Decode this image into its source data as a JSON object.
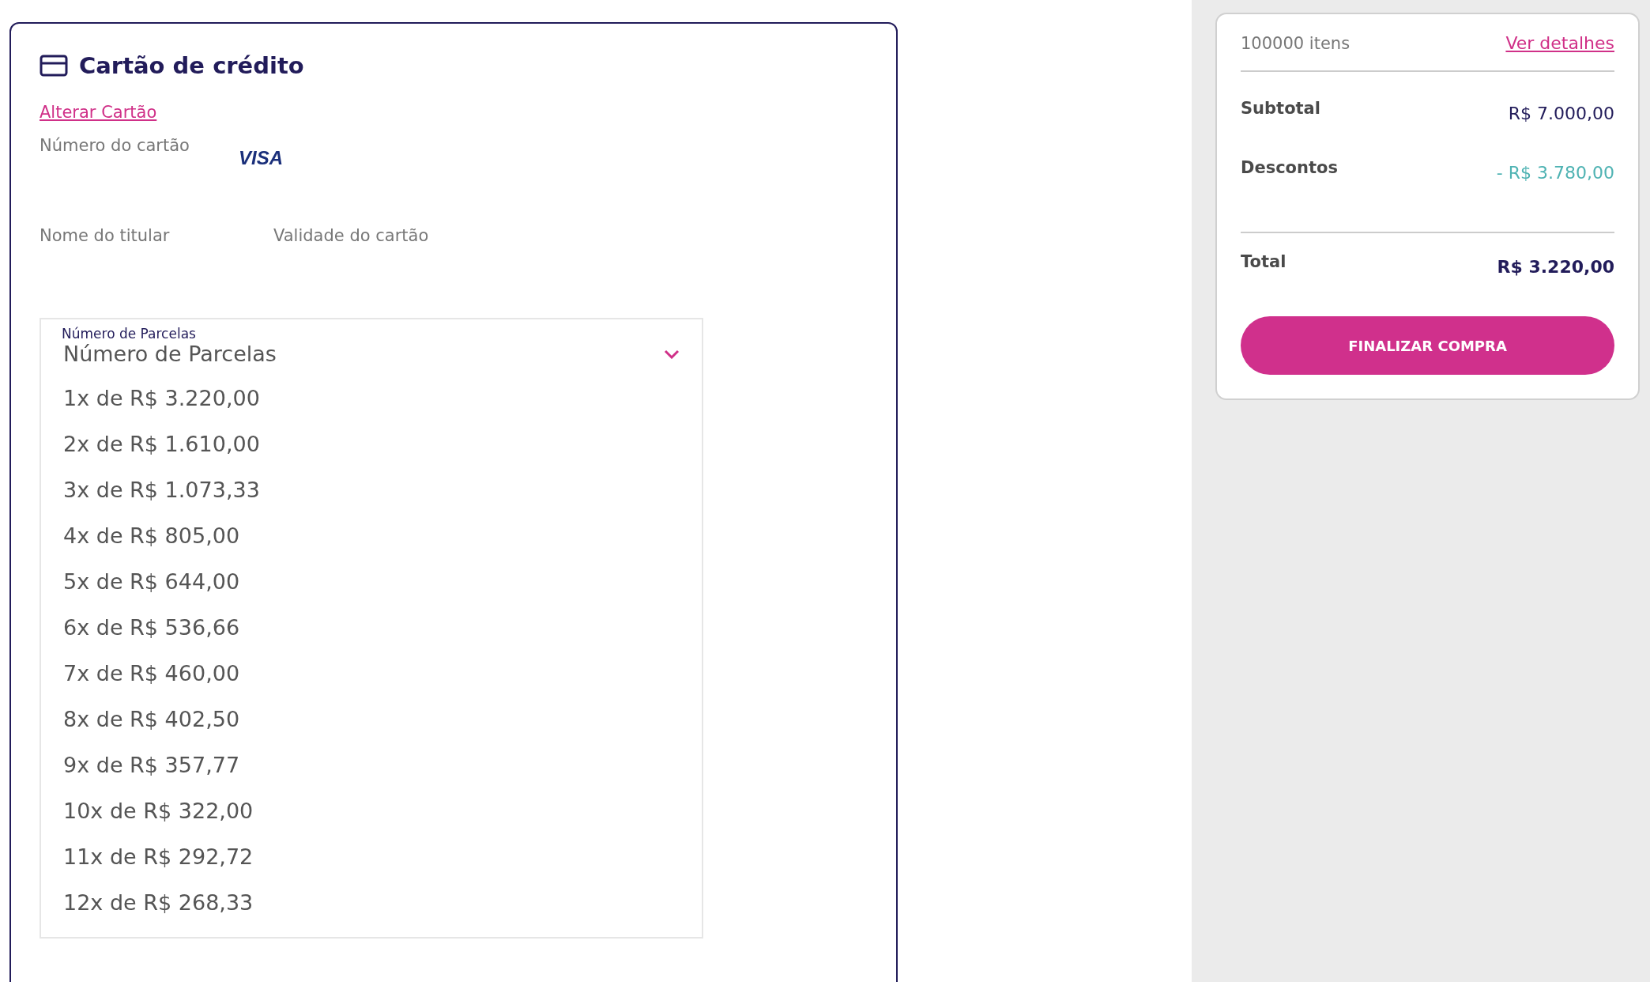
{
  "payment_card": {
    "title": "Cartão de crédito",
    "change_link": "Alterar Cartão",
    "card_number_label": "Número do cartão",
    "brand": "VISA",
    "holder_label": "Nome do titular",
    "expiry_label": "Validade do cartão",
    "installments": {
      "floating_label": "Número de Parcelas",
      "placeholder": "Número de Parcelas",
      "options": [
        {
          "label": "1x de R$ 3.220,00"
        },
        {
          "label": "2x de R$ 1.610,00"
        },
        {
          "label": "3x de R$ 1.073,33"
        },
        {
          "label": "4x de R$ 805,00"
        },
        {
          "label": "5x de R$ 644,00"
        },
        {
          "label": "6x de R$ 536,66"
        },
        {
          "label": "7x de R$ 460,00"
        },
        {
          "label": "8x de R$ 402,50"
        },
        {
          "label": "9x de R$ 357,77"
        },
        {
          "label": "10x de R$ 322,00"
        },
        {
          "label": "11x de R$ 292,72"
        },
        {
          "label": "12x de R$ 268,33"
        }
      ]
    }
  },
  "summary": {
    "items_count": "100000 itens",
    "details_link": "Ver detalhes",
    "rows": [
      {
        "label": "Subtotal",
        "value": "R$ 7.000,00",
        "kind": "plain"
      },
      {
        "label": "Descontos",
        "value": "- R$ 3.780,00",
        "kind": "discount"
      },
      {
        "label": "Total",
        "value": "R$ 3.220,00",
        "kind": "total"
      }
    ],
    "button": "FINALIZAR COMPRA"
  }
}
